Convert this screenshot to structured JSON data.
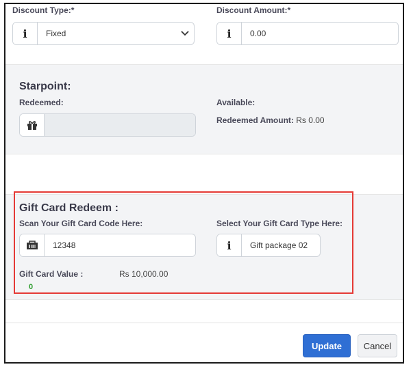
{
  "discount": {
    "type_label": "Discount Type:*",
    "type_value": "Fixed",
    "amount_label": "Discount Amount:*",
    "amount_value": "0.00"
  },
  "starpoint": {
    "title": "Starpoint:",
    "redeemed_label": "Redeemed:",
    "redeemed_value": "",
    "available_label": "Available:",
    "redeemed_amount_label": "Redeemed Amount:",
    "redeemed_amount_value": "Rs 0.00"
  },
  "gift_card": {
    "title": "Gift Card Redeem :",
    "scan_label": "Scan Your Gift Card Code Here:",
    "scan_value": "12348",
    "type_label": "Select Your Gift Card Type Here:",
    "type_value": "Gift package 02",
    "value_label": "Gift Card Value :",
    "value_amount": "Rs 10,000.00",
    "status_value": "0"
  },
  "footer": {
    "update_label": "Update",
    "cancel_label": "Cancel"
  },
  "icons": {
    "info": "info-icon",
    "gift": "gift-icon",
    "barcode": "barcode-icon",
    "chevron": "chevron-down-icon"
  },
  "colors": {
    "primary": "#2f6fd4",
    "highlight": "#e53935",
    "success": "#2e9d2e"
  }
}
